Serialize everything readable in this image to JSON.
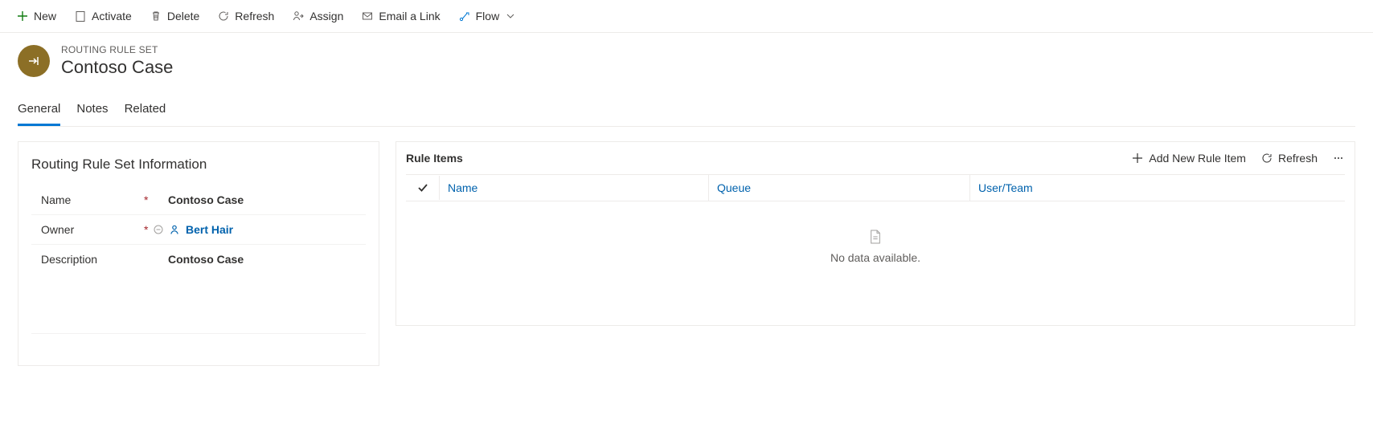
{
  "toolbar": {
    "new_label": "New",
    "activate_label": "Activate",
    "delete_label": "Delete",
    "refresh_label": "Refresh",
    "assign_label": "Assign",
    "email_link_label": "Email a Link",
    "flow_label": "Flow"
  },
  "header": {
    "entity_type": "ROUTING RULE SET",
    "title": "Contoso Case"
  },
  "tabs": [
    {
      "label": "General",
      "active": true
    },
    {
      "label": "Notes",
      "active": false
    },
    {
      "label": "Related",
      "active": false
    }
  ],
  "info": {
    "section_title": "Routing Rule Set Information",
    "name_label": "Name",
    "name_value": "Contoso Case",
    "owner_label": "Owner",
    "owner_value": "Bert Hair",
    "description_label": "Description",
    "description_value": "Contoso Case"
  },
  "rule_items": {
    "title": "Rule Items",
    "add_label": "Add New Rule Item",
    "refresh_label": "Refresh",
    "col_name": "Name",
    "col_queue": "Queue",
    "col_user": "User/Team",
    "empty_text": "No data available."
  }
}
